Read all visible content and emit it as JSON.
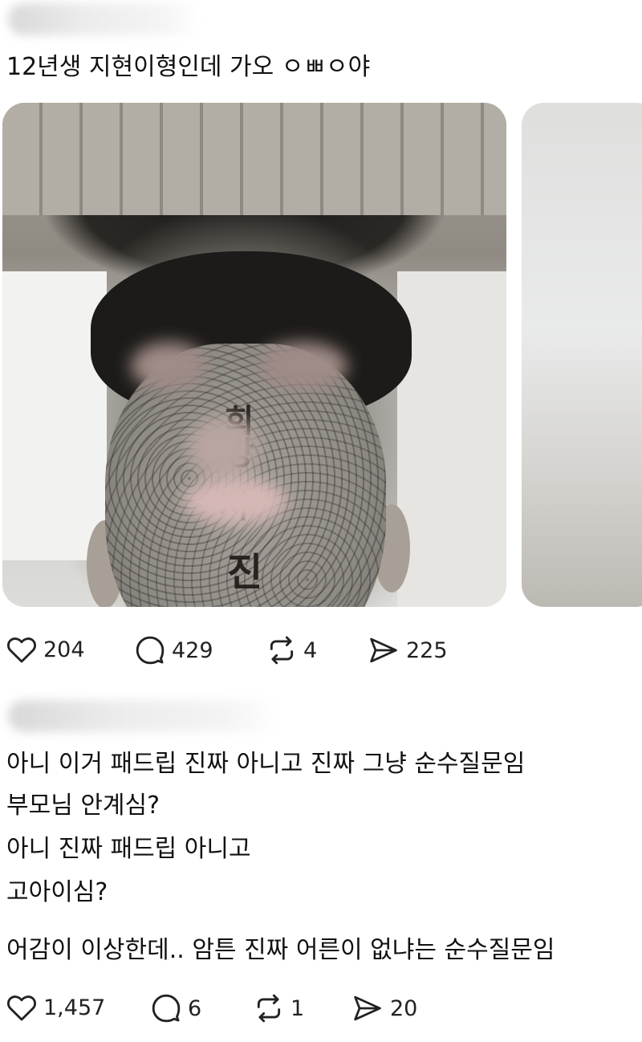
{
  "post1": {
    "text": "12년생 지현이형인데 가오 ㅇㅃㅇ야",
    "media": {
      "main_photo": "tattoo-face-photo",
      "tattoo_chars_top": "희망",
      "tattoo_chars_mid": "저",
      "tattoo_chars_bottom": "진"
    },
    "actions": {
      "like_icon": "heart-icon",
      "like_count": "204",
      "reply_icon": "comment-icon",
      "reply_count": "429",
      "repost_icon": "repost-icon",
      "repost_count": "4",
      "share_icon": "send-icon",
      "share_count": "225"
    }
  },
  "post2": {
    "lines": [
      "아니 이거 패드립 진짜 아니고 진짜 그냥 순수질문임",
      "부모님 안계심?",
      "아니 진짜 패드립 아니고",
      "고아이심?",
      "어감이 이상한데.. 암튼 진짜 어른이 없냐는 순수질문임"
    ],
    "actions": {
      "like_icon": "heart-icon",
      "like_count": "1,457",
      "reply_icon": "comment-icon",
      "reply_count": "6",
      "repost_icon": "repost-icon",
      "repost_count": "1",
      "share_icon": "send-icon",
      "share_count": "20"
    }
  },
  "colors": {
    "text": "#111111",
    "icon": "#222222",
    "background": "#ffffff"
  }
}
